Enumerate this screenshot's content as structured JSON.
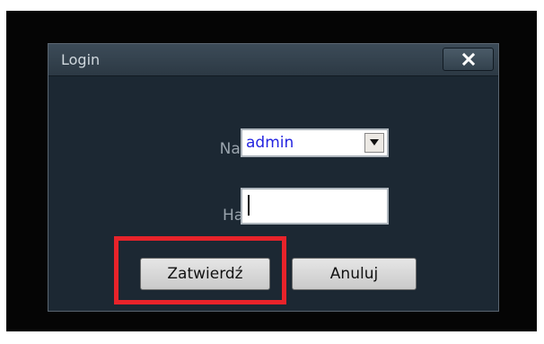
{
  "dialog": {
    "title": "Login",
    "close_icon": "close-icon"
  },
  "form": {
    "name_label": "Nazwa",
    "name_value": "admin",
    "dropdown_icon": "chevron-down-icon",
    "password_label": "Hasło:",
    "password_value": ""
  },
  "buttons": {
    "confirm_label": "Zatwierdź",
    "cancel_label": "Anuluj"
  },
  "colors": {
    "highlight": "#e8232a",
    "selected_text": "#2424e0",
    "dialog_bg": "#1c2833"
  }
}
